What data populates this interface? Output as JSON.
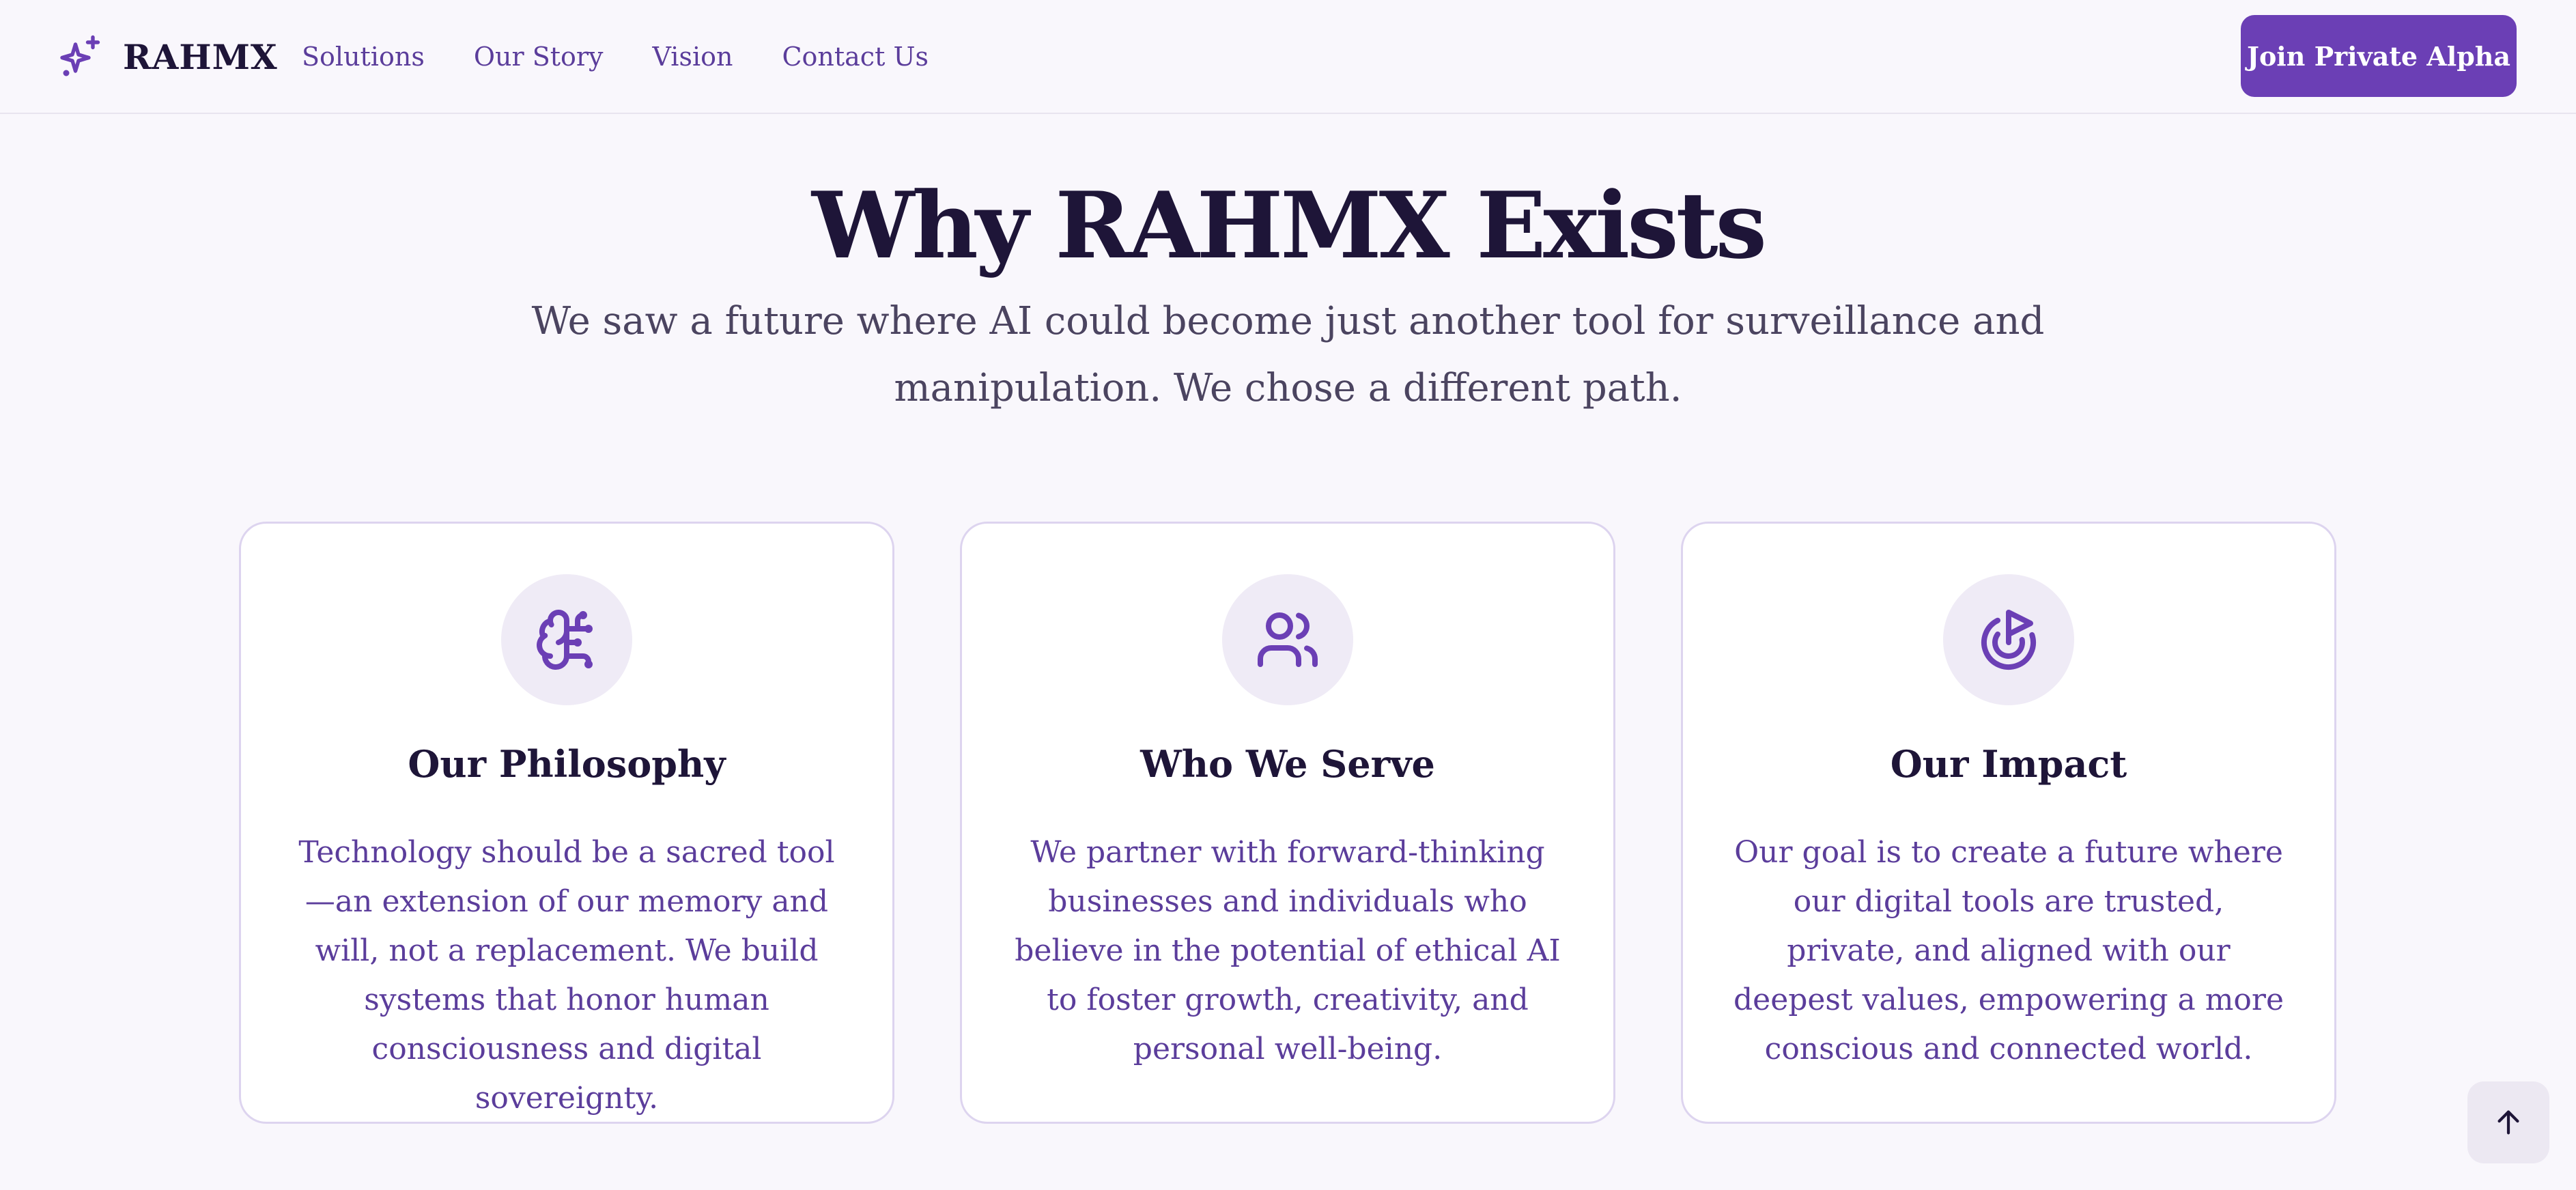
{
  "header": {
    "brand_name": "RAHMX",
    "brand_icon": "sparkles-icon",
    "nav": [
      "Solutions",
      "Our Story",
      "Vision",
      "Contact Us"
    ],
    "cta_label": "Join Private Alpha"
  },
  "hero": {
    "title": "Why RAHMX Exists",
    "subtitle": "We saw a future where AI could become just another tool for surveillance and manipulation. We chose a different path."
  },
  "cards": [
    {
      "icon": "brain-icon",
      "title": "Our Philosophy",
      "body": "Technology should be a sacred tool—an extension of our memory and will, not a replacement. We build systems that honor human consciousness and digital sovereignty."
    },
    {
      "icon": "users-icon",
      "title": "Who We Serve",
      "body": "We partner with forward-thinking businesses and individuals who believe in the potential of ethical AI to foster growth, creativity, and personal well-being."
    },
    {
      "icon": "target-icon",
      "title": "Our Impact",
      "body": "Our goal is to create a future where our digital tools are trusted, private, and aligned with our deepest values, empowering a more conscious and connected world."
    }
  ],
  "scroll_top_icon": "arrow-up-icon",
  "colors": {
    "accent": "#6b3fb5",
    "heading": "#1e1538",
    "body_text": "#5b3d9b",
    "background": "#f9f7fc"
  }
}
